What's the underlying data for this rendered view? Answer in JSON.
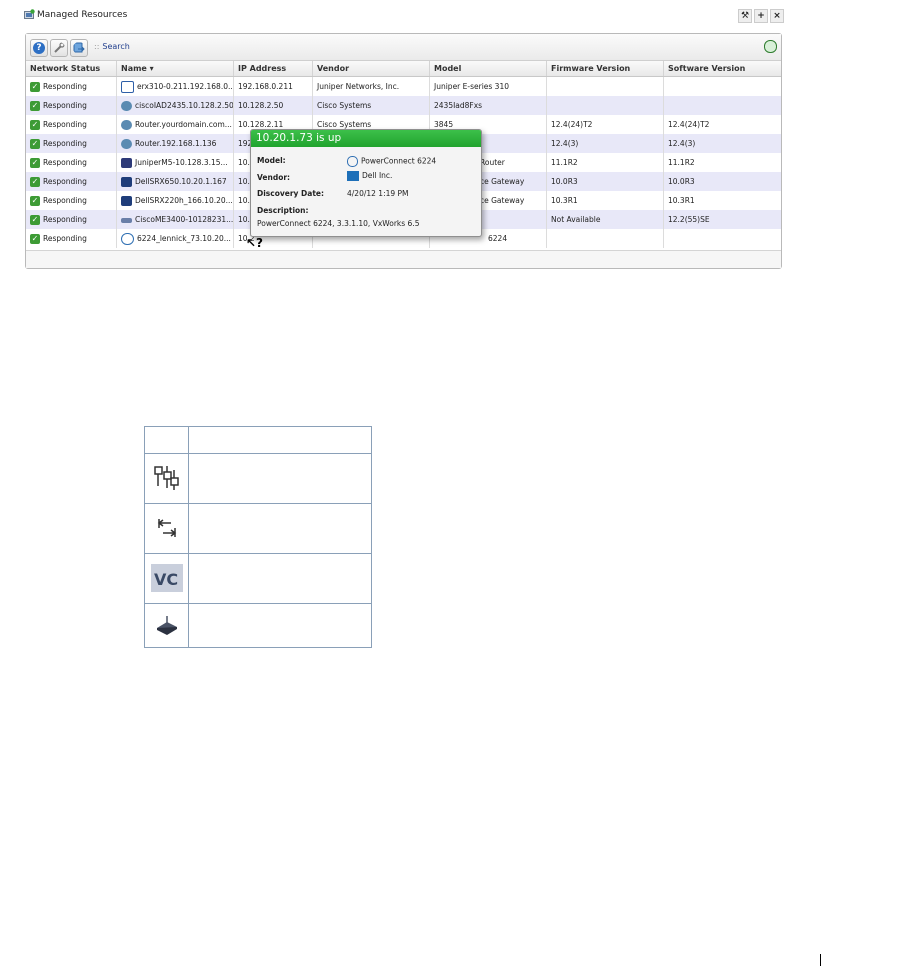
{
  "portlet": {
    "title": "Managed Resources",
    "buttons": [
      "⚒",
      "+",
      "×"
    ]
  },
  "toolbar": {
    "search_label": "Search",
    "search_separator": "::"
  },
  "columns": [
    "Network Status",
    "Name ▾",
    "IP Address",
    "Vendor",
    "Model",
    "Firmware Version",
    "Software Version"
  ],
  "rows": [
    {
      "status": "Responding",
      "name": "erx310-0.211.192.168.0...",
      "ip": "192.168.0.211",
      "vendor": "Juniper Networks, Inc.",
      "model": "Juniper E-series 310",
      "firmware": "",
      "software": ""
    },
    {
      "status": "Responding",
      "name": "ciscoIAD2435.10.128.2.50",
      "ip": "10.128.2.50",
      "vendor": "Cisco Systems",
      "model": "2435Iad8Fxs",
      "firmware": "",
      "software": ""
    },
    {
      "status": "Responding",
      "name": "Router.yourdomain.com...",
      "ip": "10.128.2.11",
      "vendor": "Cisco Systems",
      "model": "3845",
      "firmware": "12.4(24)T2",
      "software": "12.4(24)T2"
    },
    {
      "status": "Responding",
      "name": "Router.192.168.1.136",
      "ip": "192",
      "vendor": "",
      "model": "",
      "firmware": "12.4(3)",
      "software": "12.4(3)"
    },
    {
      "status": "Responding",
      "name": "JuniperM5-10.128.3.15...",
      "ip": "10.1",
      "vendor": "",
      "model": "Router",
      "firmware": "11.1R2",
      "software": "11.1R2"
    },
    {
      "status": "Responding",
      "name": "DellSRX650.10.20.1.167",
      "ip": "10.2",
      "vendor": "",
      "model": "ce Gateway",
      "firmware": "10.0R3",
      "software": "10.0R3"
    },
    {
      "status": "Responding",
      "name": "DellSRX220h_166.10.20...",
      "ip": "10.2",
      "vendor": "",
      "model": "ce Gateway",
      "firmware": "10.3R1",
      "software": "10.3R1"
    },
    {
      "status": "Responding",
      "name": "CiscoME3400-10128231...",
      "ip": "10.1",
      "vendor": "",
      "model": "",
      "firmware": "Not Available",
      "software": "12.2(55)SE"
    },
    {
      "status": "Responding",
      "name": "6224_lennick_73.10.20...",
      "ip": "10.2",
      "vendor": "",
      "model": "6224",
      "firmware": "",
      "software": ""
    }
  ],
  "popup": {
    "title": "10.20.1.73 is up",
    "model_label": "Model:",
    "model_value": "PowerConnect 6224",
    "vendor_label": "Vendor:",
    "vendor_value": "Dell Inc.",
    "date_label": "Discovery Date:",
    "date_value": "4/20/12 1:19 PM",
    "desc_label": "Description:",
    "desc_value": "PowerConnect 6224, 3.3.1.10, VxWorks 6.5"
  },
  "cursor_glyph": "↖?",
  "colors": {
    "popup_header": "#2db43a",
    "row_alt": "#e8e8f8",
    "status_check": "#3d9b35",
    "link": "#23408e"
  },
  "legend_icons": [
    "switch-stack-icon",
    "link-aggregation-icon",
    "virtual-chassis-icon",
    "router-icon"
  ]
}
